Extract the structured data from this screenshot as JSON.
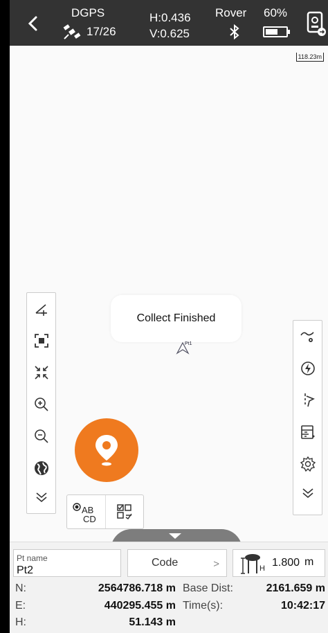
{
  "status": {
    "solution": "DGPS",
    "satellites": "17/26",
    "h_precision": "H:0.436",
    "v_precision": "V:0.625",
    "mode": "Rover",
    "battery": "60%",
    "battery_level": 0.6
  },
  "map": {
    "scale_label": "118.23m",
    "point_label": "Pt1",
    "toast": "Collect Finished"
  },
  "left_tools": [
    {
      "name": "measure-tool-icon"
    },
    {
      "name": "fit-extent-icon"
    },
    {
      "name": "zoom-to-point-icon"
    },
    {
      "name": "zoom-in-icon"
    },
    {
      "name": "zoom-out-icon"
    },
    {
      "name": "globe-icon"
    },
    {
      "name": "collapse-icon"
    }
  ],
  "right_tools": [
    {
      "name": "route-settings-icon"
    },
    {
      "name": "quick-action-icon"
    },
    {
      "name": "stakeout-icon"
    },
    {
      "name": "point-list-icon"
    },
    {
      "name": "settings-icon"
    },
    {
      "name": "collapse-icon"
    }
  ],
  "mini_panel": {
    "ab_label": "AB",
    "cd_label": "CD"
  },
  "panel": {
    "pt_name_label": "Pt name",
    "pt_name_value": "Pt2",
    "code_label": "Code",
    "code_arrow": ">",
    "antenna_suffix": "H",
    "antenna_height": "1.800",
    "antenna_unit": "m",
    "n_label": "N:",
    "n_value": "2564786.718 m",
    "e_label": "E:",
    "e_value": "440295.455 m",
    "h_label": "H:",
    "h_value": "51.143 m",
    "base_dist_label": "Base Dist:",
    "base_dist_value": "2161.659 m",
    "time_label": "Time(s):",
    "time_value": "10:42:17"
  },
  "colors": {
    "topbar": "#333333",
    "accent": "#ef7a1f"
  }
}
